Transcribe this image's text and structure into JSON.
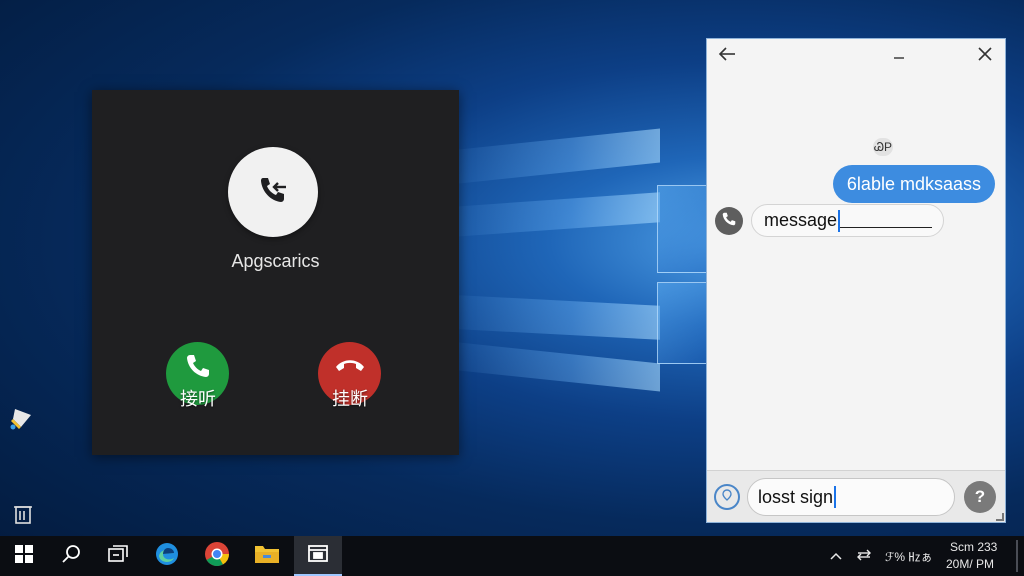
{
  "call_window": {
    "caller_name": "Apgscarics",
    "accept_label": "接听",
    "decline_label": "挂断"
  },
  "chat_window": {
    "timestamp_badge": "ᏊP",
    "sent_message": "6lable mdksaass",
    "received_message": "message",
    "input_value": "losst sign"
  },
  "taskbar": {
    "tray_status": "ℱ% ㎐ぁ",
    "clock_time": "Scm 233",
    "clock_date": "20M/ PM"
  },
  "colors": {
    "accept": "#1f9a3e",
    "decline": "#c0302a",
    "chat_bubble": "#3d8ce0"
  },
  "icons": {
    "desktop": [
      "paint-bucket-icon",
      "recycle-bin-icon"
    ],
    "taskbar": [
      "windows-start-icon",
      "search-icon",
      "task-view-icon",
      "edge-icon",
      "chrome-icon",
      "file-explorer-icon",
      "app-icon"
    ],
    "tray": [
      "chevron-up-icon",
      "network-icon",
      "volume-icon",
      "notification-icon"
    ]
  }
}
